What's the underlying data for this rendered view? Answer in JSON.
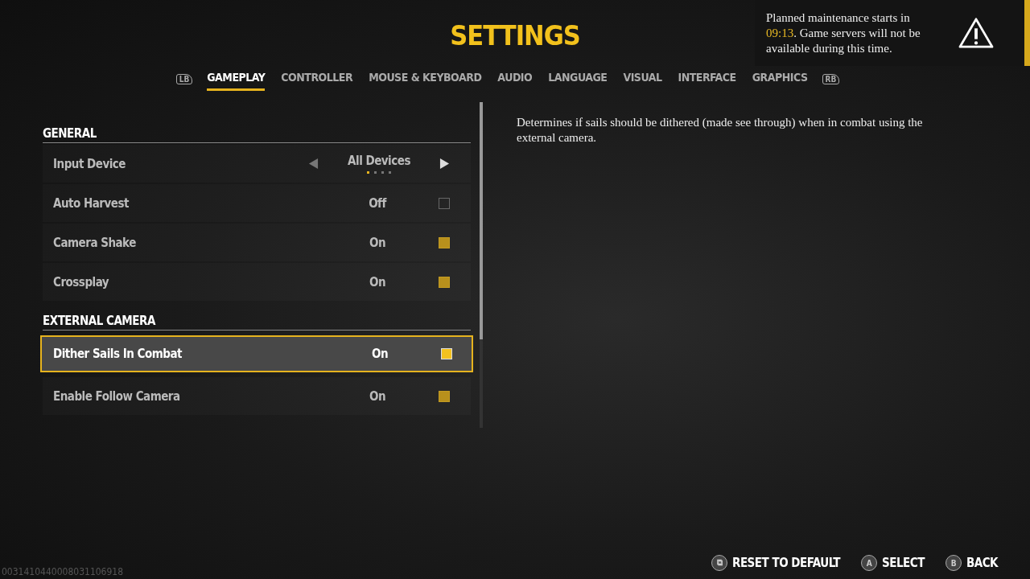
{
  "title": "SETTINGS",
  "tabs": [
    {
      "label": "GAMEPLAY",
      "selected": true
    },
    {
      "label": "CONTROLLER",
      "selected": false
    },
    {
      "label": "MOUSE & KEYBOARD",
      "selected": false
    },
    {
      "label": "AUDIO",
      "selected": false
    },
    {
      "label": "LANGUAGE",
      "selected": false
    },
    {
      "label": "VISUAL",
      "selected": false
    },
    {
      "label": "INTERFACE",
      "selected": false
    },
    {
      "label": "GRAPHICS",
      "selected": false
    }
  ],
  "tab_prev_key": "LB",
  "tab_next_key": "RB",
  "sections": [
    {
      "title": "GENERAL",
      "rows": [
        {
          "kind": "selector",
          "label": "Input Device",
          "value": "All Devices",
          "selected": false,
          "pages": [
            {
              "selected": true
            },
            {
              "selected": false
            },
            {
              "selected": false
            },
            {
              "selected": false
            }
          ]
        },
        {
          "kind": "toggle",
          "label": "Auto Harvest",
          "value": "Off",
          "checked": false,
          "selected": false
        },
        {
          "kind": "toggle",
          "label": "Camera Shake",
          "value": "On",
          "checked": true,
          "selected": false
        },
        {
          "kind": "toggle",
          "label": "Crossplay",
          "value": "On",
          "checked": true,
          "selected": false
        }
      ]
    },
    {
      "title": "EXTERNAL CAMERA",
      "rows": [
        {
          "kind": "toggle",
          "label": "Dither Sails In Combat",
          "value": "On",
          "checked": true,
          "selected": true
        },
        {
          "kind": "toggle",
          "label": "Enable Follow Camera",
          "value": "On",
          "checked": true,
          "selected": false
        }
      ]
    }
  ],
  "description": "Determines if sails should be dithered (made see through) when in combat using the external camera.",
  "notice": {
    "before": "Planned maintenance starts in ",
    "time": "09:13",
    "after": ". Game servers will not be available during this time."
  },
  "footer_actions": [
    {
      "key": "⧉",
      "label": "RESET TO DEFAULT"
    },
    {
      "key": "A",
      "label": "SELECT"
    },
    {
      "key": "B",
      "label": "BACK"
    }
  ],
  "build_id": "0031410440008031106918"
}
